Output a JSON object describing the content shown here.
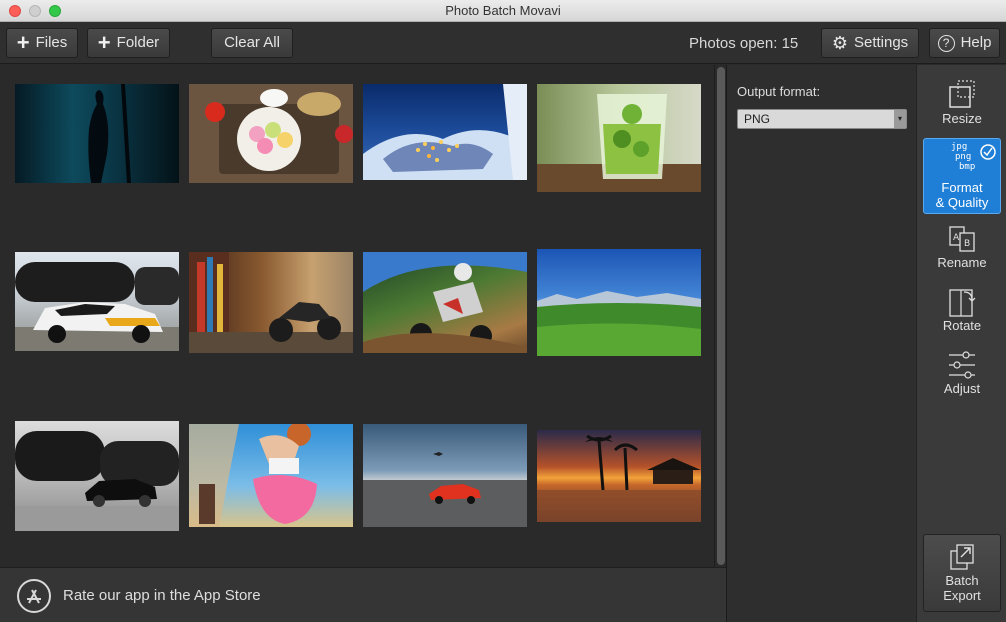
{
  "window": {
    "title": "Photo Batch Movavi"
  },
  "toolbar": {
    "files_label": "Files",
    "folder_label": "Folder",
    "clear_all_label": "Clear All",
    "photos_open_label": "Photos open: 15",
    "settings_label": "Settings",
    "help_label": "Help",
    "help_glyph": "?"
  },
  "icons": {
    "plus": "+",
    "gear": "⚙",
    "select_arrow": "▾"
  },
  "settings": {
    "output_format_label": "Output format:",
    "output_format_value": "PNG"
  },
  "tools": {
    "resize": "Resize",
    "format_quality_line1": "Format",
    "format_quality_line2": "& Quality",
    "format_icon_jpg": "jpg",
    "format_icon_png": "png",
    "format_icon_bmp": "bmp",
    "rename": "Rename",
    "rotate": "Rotate",
    "adjust": "Adjust",
    "batch_export_line1": "Batch",
    "batch_export_line2": "Export"
  },
  "footer": {
    "rate_text": "Rate our app in the App Store"
  },
  "photos": [
    {
      "subject": "underwater-silhouette"
    },
    {
      "subject": "macarons-breakfast"
    },
    {
      "subject": "snowy-village-night"
    },
    {
      "subject": "mojito-glass"
    },
    {
      "subject": "rally-car-train"
    },
    {
      "subject": "motorcycle-graffiti"
    },
    {
      "subject": "motocross-rider"
    },
    {
      "subject": "green-valley-landscape"
    },
    {
      "subject": "train-black-car"
    },
    {
      "subject": "woman-basketball"
    },
    {
      "subject": "red-sports-car"
    },
    {
      "subject": "tropical-sunset"
    }
  ],
  "colors": {
    "accent": "#1f7fd6",
    "panel_bg": "#2e2e2e",
    "grid_bg": "#2a2a2a"
  }
}
